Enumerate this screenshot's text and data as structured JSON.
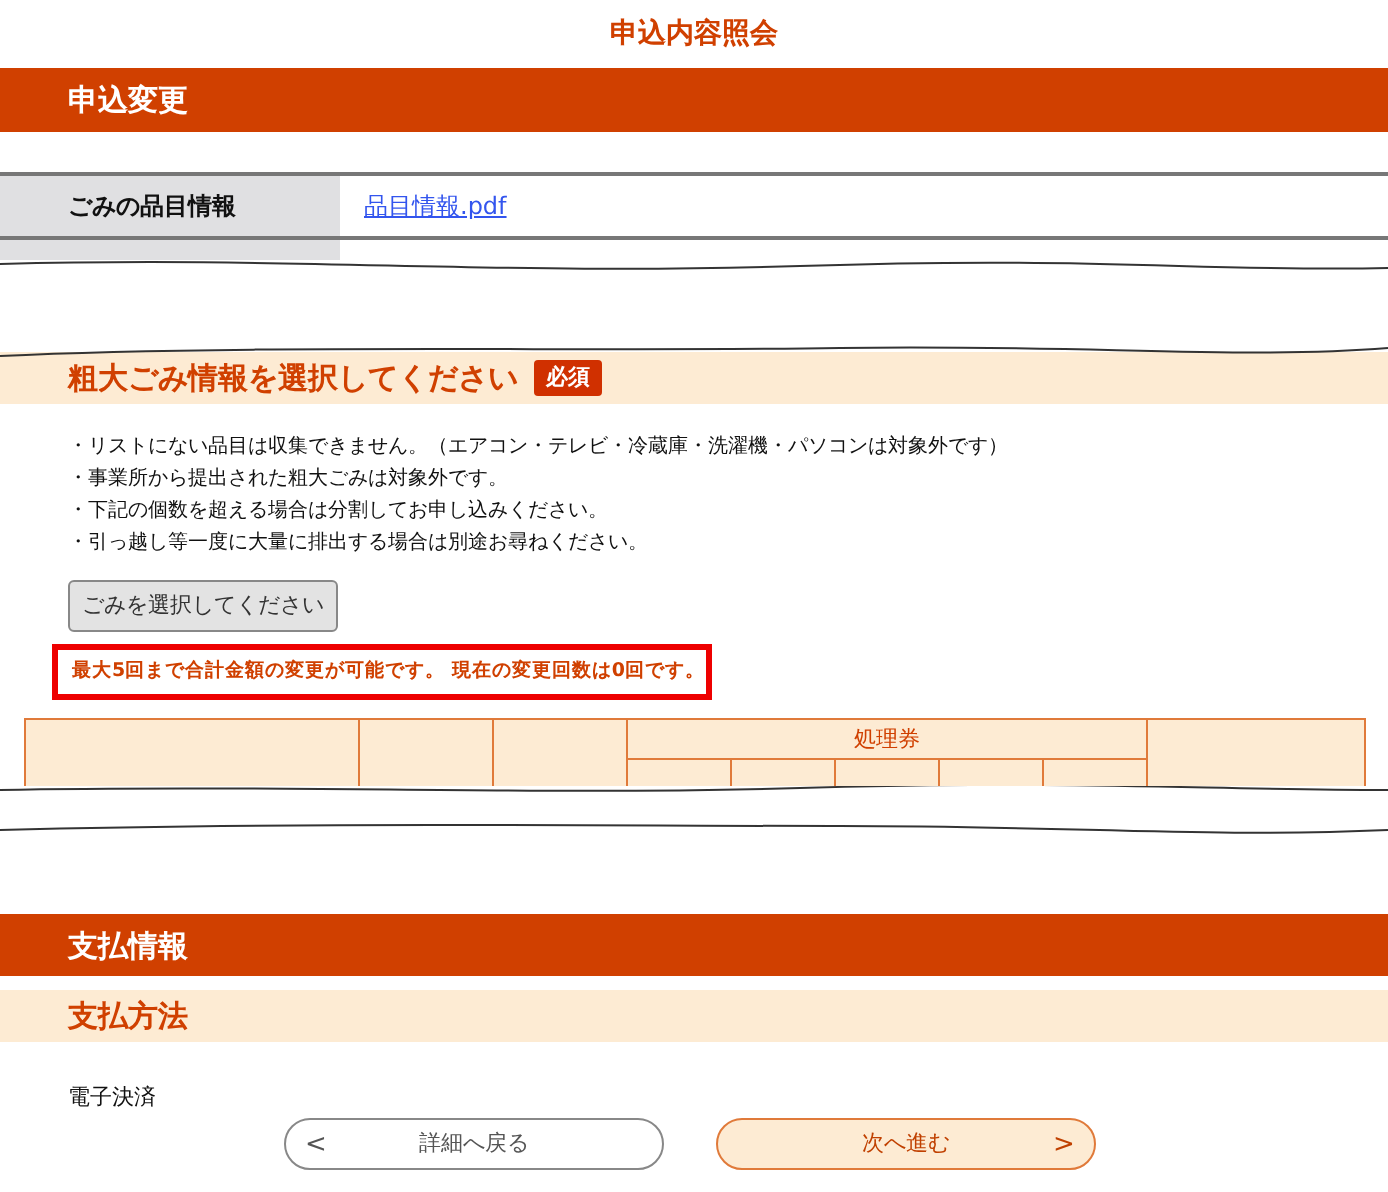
{
  "page_title": "申込内容照会",
  "change_section": {
    "title": "申込変更",
    "rows": [
      {
        "label": "ごみの品目情報",
        "link": "品目情報.pdf"
      }
    ]
  },
  "bulky_section": {
    "title": "粗大ごみ情報を選択してください",
    "badge": "必須",
    "notes": [
      "・リストにない品目は収集できません。（エアコン・テレビ・冷蔵庫・洗濯機・パソコンは対象外です）",
      "・事業所から提出された粗大ごみは対象外です。",
      "・下記の個数を超える場合は分割してお申し込みください。",
      "・引っ越し等一度に大量に排出する場合は別途お尋ねください。"
    ],
    "select_button": "ごみを選択してください",
    "notice": "最大5回まで合計金額の変更が可能です。 現在の変更回数は0回です。",
    "table": {
      "group_header": "処理券"
    }
  },
  "payment_section": {
    "title": "支払情報",
    "subtitle": "支払方法",
    "method": "電子決済"
  },
  "buttons": [
    {
      "kind": "back",
      "label": "詳細へ戻る",
      "icon": "<"
    },
    {
      "kind": "next",
      "label": "次へ進む",
      "icon": ">"
    }
  ]
}
